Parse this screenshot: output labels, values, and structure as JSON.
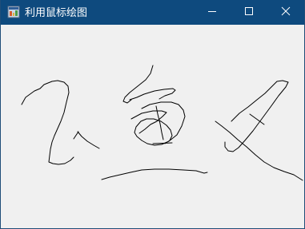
{
  "window": {
    "title": "利用鼠标绘图",
    "icon": "windows-form-app-icon",
    "controls": {
      "minimize_icon": "minimize-icon",
      "maximize_icon": "maximize-icon",
      "close_icon": "close-icon"
    }
  },
  "colors": {
    "titlebar": "#0e4a7e",
    "canvas_background": "#f0f0f0",
    "stroke": "#000000"
  }
}
